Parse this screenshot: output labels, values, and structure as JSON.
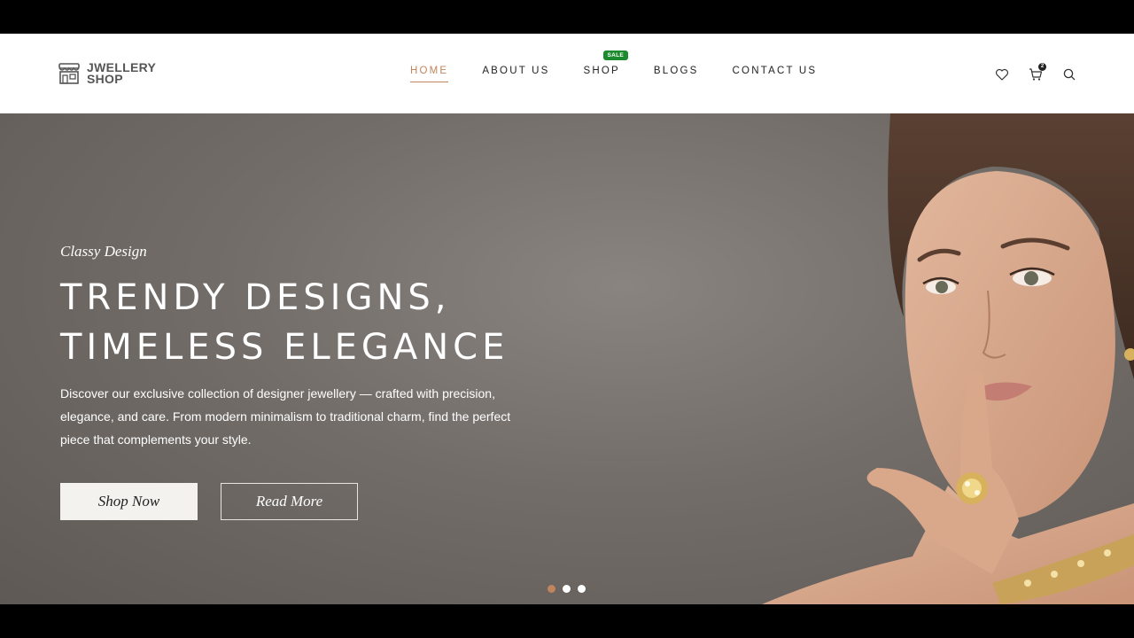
{
  "header": {
    "logo": {
      "line1": "JWELLERY",
      "line2": "SHOP"
    },
    "nav": [
      {
        "label": "HOME",
        "active": true
      },
      {
        "label": "ABOUT US",
        "active": false
      },
      {
        "label": "SHOP",
        "active": false,
        "badge": "SALE"
      },
      {
        "label": "BLOGS",
        "active": false
      },
      {
        "label": "CONTACT US",
        "active": false
      }
    ],
    "icons": {
      "wishlist": "heart-icon",
      "cart": "cart-icon",
      "cart_count": "2",
      "search": "search-icon"
    }
  },
  "hero": {
    "eyebrow": "Classy Design",
    "headline_line1": "TRENDY DESIGNS,",
    "headline_line2": "TIMELESS ELEGANCE",
    "description": "Discover our exclusive collection of designer jewellery — crafted with precision, elegance, and care. From modern minimalism to traditional charm, find the perfect piece that complements your style.",
    "primary_button": "Shop Now",
    "secondary_button": "Read More",
    "slides": {
      "count": 3,
      "active_index": 0
    }
  },
  "colors": {
    "accent": "#c0855c",
    "badge": "#1c8a2e",
    "hero_bg": "#736d69",
    "header_bg": "#ffffff"
  }
}
